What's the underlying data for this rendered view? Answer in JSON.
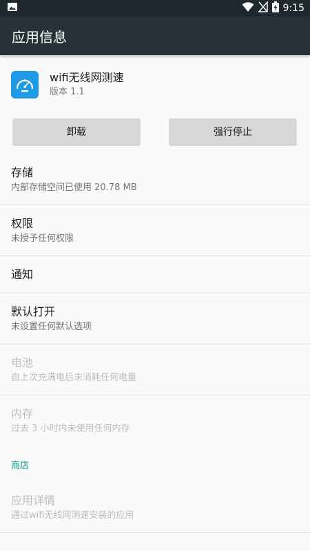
{
  "status_bar": {
    "time": "9:15",
    "icons": [
      "image-icon",
      "wifi-icon",
      "no-sim-icon",
      "battery-charging-icon"
    ]
  },
  "app_bar": {
    "title": "应用信息"
  },
  "app": {
    "name": "wifi无线网测速",
    "version": "版本 1.1",
    "icon": "speedometer-icon"
  },
  "buttons": {
    "uninstall": "卸载",
    "force_stop": "强行停止"
  },
  "items": {
    "storage": {
      "title": "存储",
      "subtitle": "内部存储空间已使用 20.78 MB"
    },
    "permissions": {
      "title": "权限",
      "subtitle": "未授予任何权限"
    },
    "notifications": {
      "title": "通知"
    },
    "open_by_default": {
      "title": "默认打开",
      "subtitle": "未设置任何默认选项"
    },
    "battery": {
      "title": "电池",
      "subtitle": "自上次充满电后未消耗任何电量"
    },
    "memory": {
      "title": "内存",
      "subtitle": "过去 3 小时内未使用任何内存"
    }
  },
  "store": {
    "header": "商店",
    "details": {
      "title": "应用详情",
      "subtitle": "通过wifi无线网测速安装的应用"
    }
  },
  "colors": {
    "status_bar": "#1f282d",
    "app_bar": "#263238",
    "accent": "#009688",
    "app_icon": "#1e9ae6",
    "button": "#d6d7d7"
  }
}
